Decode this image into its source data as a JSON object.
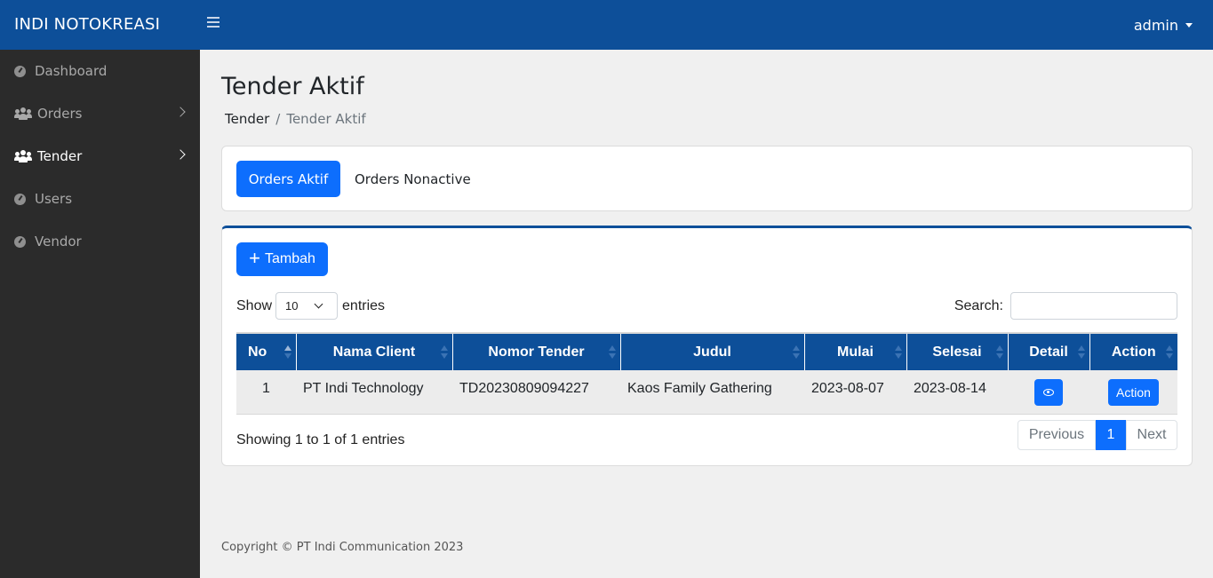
{
  "app": {
    "brand": "INDI NOTOKREASI",
    "user": "admin"
  },
  "sidebar": {
    "items": [
      {
        "label": "Dashboard",
        "icon": "dashboard-icon"
      },
      {
        "label": "Orders",
        "icon": "users-icon",
        "has_submenu": true
      },
      {
        "label": "Tender",
        "icon": "users-icon",
        "has_submenu": true,
        "active": true
      },
      {
        "label": "Users",
        "icon": "dashboard-icon"
      },
      {
        "label": "Vendor",
        "icon": "dashboard-icon"
      }
    ]
  },
  "page": {
    "title": "Tender Aktif",
    "breadcrumb": [
      "Tender",
      "Tender Aktif"
    ],
    "breadcrumb_sep": "/"
  },
  "tabs": {
    "active": "Orders Aktif",
    "inactive": "Orders Nonactive"
  },
  "toolbar": {
    "add_label": "Tambah",
    "add_icon": "plus-icon"
  },
  "table_controls": {
    "show_label": "Show",
    "entries_label": "entries",
    "page_length": "10",
    "search_label": "Search:",
    "search_value": ""
  },
  "table": {
    "columns": [
      "No",
      "Nama Client",
      "Nomor Tender",
      "Judul",
      "Mulai",
      "Selesai",
      "Detail",
      "Action"
    ],
    "rows": [
      {
        "no": "1",
        "client": "PT Indi Technology",
        "nomor": "TD20230809094227",
        "judul": "Kaos Family Gathering",
        "mulai": "2023-08-07",
        "selesai": "2023-08-14",
        "detail_icon": "eye-icon",
        "action_label": "Action"
      }
    ]
  },
  "pagination": {
    "info": "Showing 1 to 1 of 1 entries",
    "previous": "Previous",
    "current": "1",
    "next": "Next"
  },
  "footer": {
    "text": "Copyright © PT Indi Communication 2023"
  },
  "colors": {
    "topbar": "#0d4f99",
    "sidebar": "#2b2b2b",
    "primary": "#0d6efd",
    "table_header": "#0d4f99"
  }
}
